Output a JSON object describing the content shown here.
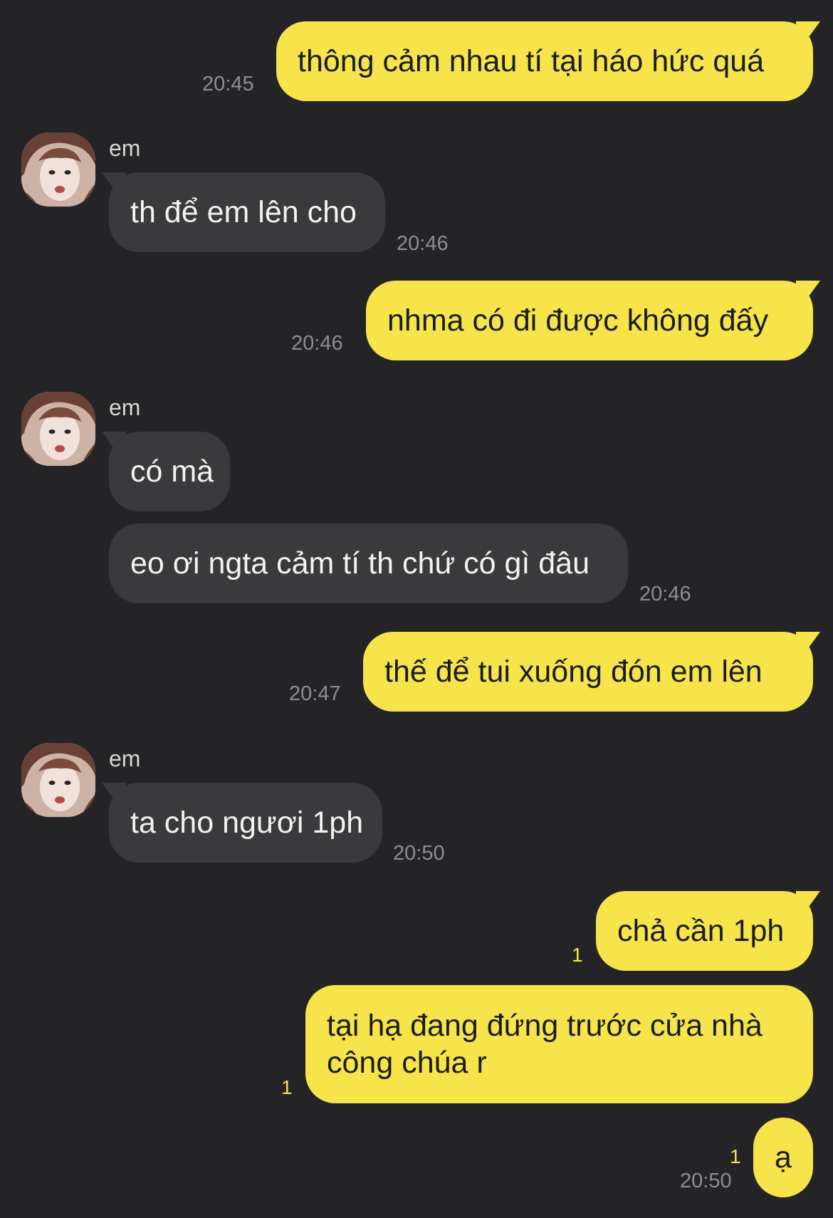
{
  "contact": {
    "name": "em",
    "avatar_icon": "profile-photo-icon"
  },
  "colors": {
    "background": "#242426",
    "my_bubble": "#f6e44a",
    "their_bubble": "#3a3a3c",
    "timestamp": "#8e8e92",
    "unread_count": "#f6e44a"
  },
  "messages": [
    {
      "from": "me",
      "text": "thông cảm nhau tí tại háo hức quá",
      "time": "20:45"
    },
    {
      "from": "em",
      "sender": "em",
      "text": "th để em lên cho",
      "time": "20:46"
    },
    {
      "from": "me",
      "text": "nhma có đi được không đấy",
      "time": "20:46"
    },
    {
      "from": "em",
      "sender": "em",
      "text": "có mà",
      "time": ""
    },
    {
      "from": "em",
      "text": "eo ơi ngta cảm tí th chứ có gì đâu",
      "time": "20:46"
    },
    {
      "from": "me",
      "text": "thế để tui xuống đón em lên",
      "time": "20:47"
    },
    {
      "from": "em",
      "sender": "em",
      "text": "ta cho ngươi 1ph",
      "time": "20:50"
    },
    {
      "from": "me",
      "text": "chả cần 1ph",
      "unread": "1"
    },
    {
      "from": "me",
      "text": "tại hạ đang đứng trước cửa nhà công chúa r",
      "unread": "1"
    },
    {
      "from": "me",
      "text": "ạ",
      "unread": "1",
      "time": "20:50"
    }
  ]
}
